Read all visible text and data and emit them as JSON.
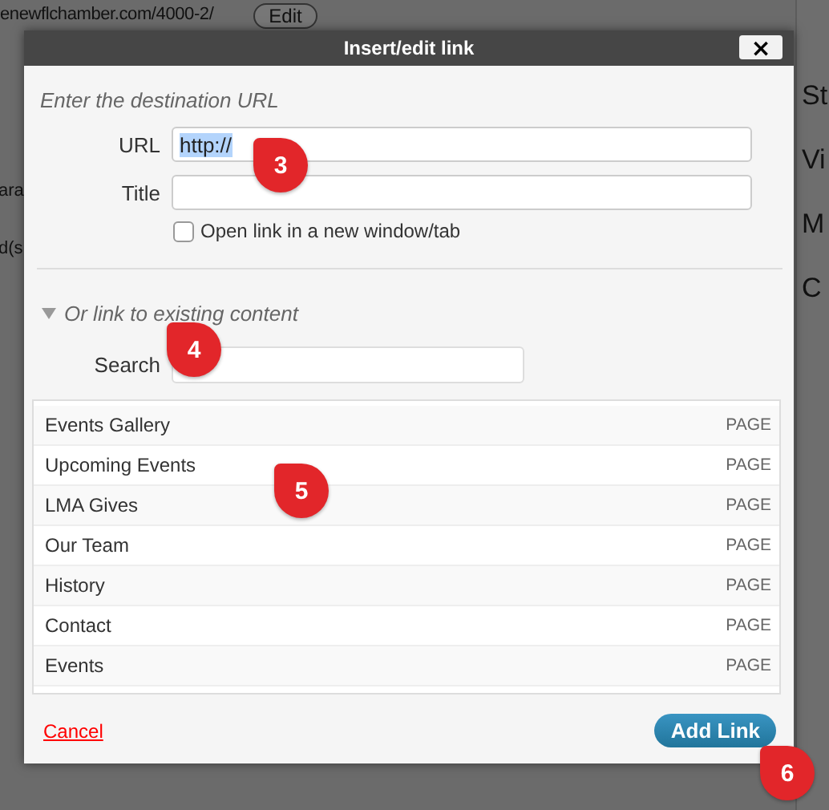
{
  "background": {
    "url_fragment": "enewflchamber.com/4000-2/",
    "edit_button": "Edit",
    "right_fragments": [
      "St",
      "Vi",
      "M",
      "C"
    ],
    "left_fragments": [
      "ara",
      "d(s"
    ]
  },
  "dialog": {
    "title": "Insert/edit link",
    "close": "×",
    "url_section": {
      "heading": "Enter the destination URL",
      "fields": [
        {
          "label": "URL",
          "value": "http://",
          "highlighted": true
        },
        {
          "label": "Title"
        }
      ],
      "new_tab": {
        "label": "Open link in a new window/tab",
        "checked": false
      }
    },
    "existing": {
      "heading": "Or link to existing content",
      "expanded": true,
      "search_label": "Search",
      "results": [
        {
          "title": "Events Gallery",
          "type": "PAGE"
        },
        {
          "title": "Upcoming Events",
          "type": "PAGE"
        },
        {
          "title": "LMA Gives",
          "type": "PAGE"
        },
        {
          "title": "Our Team",
          "type": "PAGE"
        },
        {
          "title": "History",
          "type": "PAGE"
        },
        {
          "title": "Contact",
          "type": "PAGE"
        },
        {
          "title": "Events",
          "type": "PAGE"
        }
      ]
    },
    "cancel": "Cancel",
    "submit": "Add Link"
  },
  "markers": [
    {
      "label": "3"
    },
    {
      "label": "4"
    },
    {
      "label": "5"
    },
    {
      "label": "6"
    }
  ]
}
